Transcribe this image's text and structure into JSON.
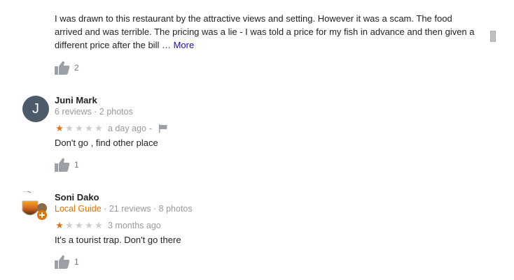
{
  "reviews": [
    {
      "text": "I was drawn to this restaurant by the attractive views and setting. However it was a scam. The food arrived and was terrible. The pricing was a lie - I was told a price for my fish in advance and then given a different price after the bill",
      "ellipsis": "…",
      "more_label": "More",
      "likes": "2"
    },
    {
      "avatar_letter": "J",
      "name": "Juni Mark",
      "meta": "6 reviews · 2 photos",
      "rating": 1,
      "time": "a day ago",
      "separator": "-",
      "text": "Don't go , find other place",
      "likes": "1"
    },
    {
      "name": "Soni Dako",
      "local_guide": "Local Guide",
      "meta": " · 21 reviews · 8 photos",
      "rating": 1,
      "time": "3 months ago",
      "text": "It's a tourist trap. Don't go there",
      "likes": "1"
    }
  ],
  "colors": {
    "star_filled": "#e7711b",
    "star_empty": "#cccccc",
    "local_guide": "#e37400",
    "more_link": "#1a0dab",
    "avatar_bg": "#4b5b6a"
  },
  "icons": [
    "thumbs-up-icon",
    "flag-icon",
    "star-icon",
    "local-guide-badge-icon"
  ]
}
